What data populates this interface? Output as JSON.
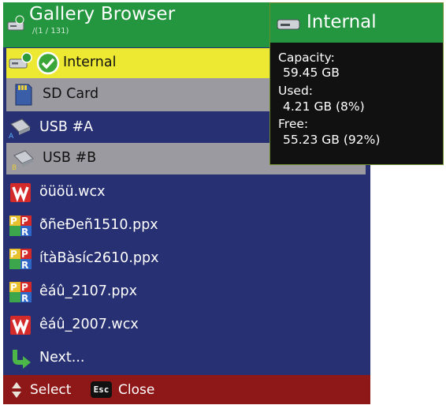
{
  "header": {
    "title": "Gallery Browser",
    "subtitle": "/(1 / 131)"
  },
  "list": [
    {
      "label": "Internal",
      "icon": "internal-drive-check-icon"
    },
    {
      "label": "SD Card",
      "icon": "sd-card-icon"
    },
    {
      "label": "USB #A",
      "icon": "usb-drive-icon",
      "badge": "A"
    },
    {
      "label": "USB #B",
      "icon": "usb-drive-icon",
      "badge": "B"
    },
    {
      "label": "öüöü.wcx",
      "icon": "wcx-file-icon"
    },
    {
      "label": "ðñeÐeñ1510.ppx",
      "icon": "ppx-file-icon"
    },
    {
      "label": "ítàBàsíc2610.ppx",
      "icon": "ppx-file-icon"
    },
    {
      "label": "êáû_2107.ppx",
      "icon": "ppx-file-icon"
    },
    {
      "label": "êáû_2007.wcx",
      "icon": "wcx-file-icon"
    },
    {
      "label": "Next...",
      "icon": "next-arrow-icon"
    }
  ],
  "footer": {
    "select_label": "Select",
    "esc_key": "Esc",
    "close_label": "Close"
  },
  "info": {
    "title": "Internal",
    "capacity_label": "Capacity:",
    "capacity_value": "59.45 GB",
    "used_label": "Used:",
    "used_value": "4.21 GB (8%)",
    "free_label": "Free:",
    "free_value": "55.23 GB (92%)"
  },
  "colors": {
    "header_green": "#23963f",
    "list_blue": "#273072",
    "selection_yellow": "#ede832",
    "highlight_gray": "#9a9aa0",
    "footer_red": "#8e1717"
  }
}
